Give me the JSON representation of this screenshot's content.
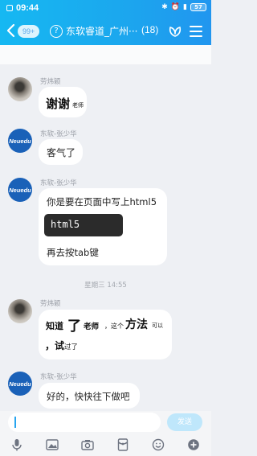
{
  "status_bar": {
    "time": "09:44",
    "battery": "57"
  },
  "header": {
    "unread_badge": "99+",
    "title": "东软睿道_广州···",
    "member_count": "(18)"
  },
  "messages": [
    {
      "sender": "劳炜颖",
      "text_main": "谢谢",
      "text_suffix": "老师"
    },
    {
      "sender": "东软-张少华",
      "avatar_text": "Neuedu",
      "text": "客气了"
    },
    {
      "sender": "东软-张少华",
      "avatar_text": "Neuedu",
      "line1": "你是要在页面中写上html5",
      "code": "html5",
      "line3": "再去按tab键"
    },
    {
      "timestamp": "星期三 14:55"
    },
    {
      "sender": "劳炜颖",
      "hw1": "知道",
      "hw2": "了",
      "hw3": "老师",
      "hw4": "，这个",
      "hw5": "方法",
      "hw6": "可以",
      "hw7": "，试",
      "hw8": "过了"
    },
    {
      "sender": "东软-张少华",
      "avatar_text": "Neuedu",
      "text": "好的，快快往下做吧"
    }
  ],
  "composer": {
    "send_label": "发送"
  },
  "toolbar_icons": [
    "microphone-icon",
    "image-icon",
    "camera-icon",
    "red-packet-icon",
    "emoji-icon",
    "plus-icon"
  ],
  "colors": {
    "header_blue": "#1ba8ee",
    "send_disabled": "#bfe7fb",
    "neuedu_blue": "#1a61b8"
  }
}
